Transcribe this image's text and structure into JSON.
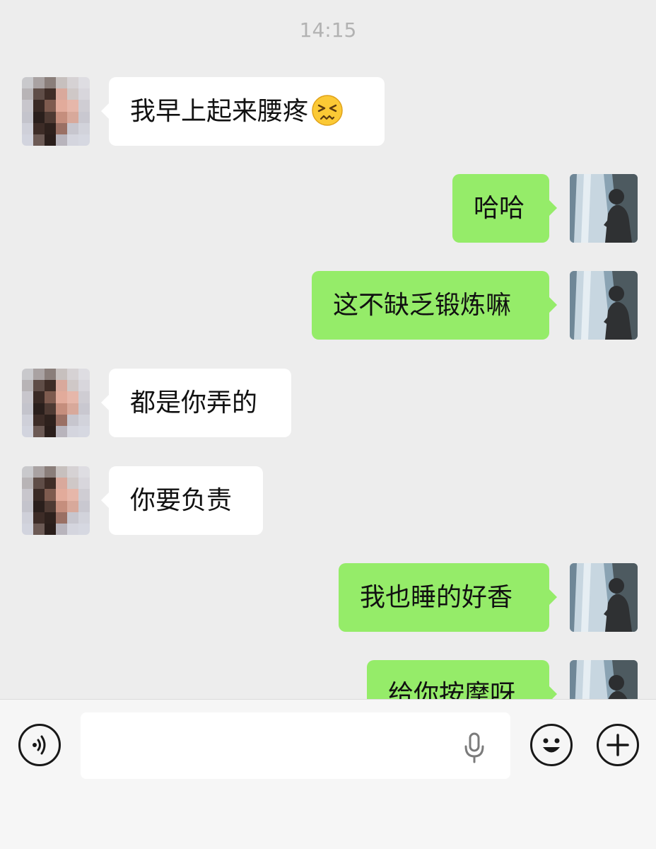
{
  "status": {
    "time": "14:15"
  },
  "messages": [
    {
      "side": "in",
      "text": "我早上起来腰疼",
      "emoji": "persevering-face"
    },
    {
      "side": "out",
      "text": "哈哈"
    },
    {
      "side": "out",
      "text": "这不缺乏锻炼嘛"
    },
    {
      "side": "in",
      "text": "都是你弄的"
    },
    {
      "side": "in",
      "text": "你要负责"
    },
    {
      "side": "out",
      "text": "我也睡的好香"
    },
    {
      "side": "out",
      "text": "给你按摩呀"
    }
  ],
  "input_bar": {
    "voice_icon": "voice-icon",
    "mic_icon": "microphone-icon",
    "emoji_icon": "emoji-icon",
    "plus_icon": "plus-icon",
    "value": ""
  },
  "colors": {
    "background": "#ededed",
    "outgoing_bubble": "#95ec69",
    "incoming_bubble": "#ffffff"
  }
}
